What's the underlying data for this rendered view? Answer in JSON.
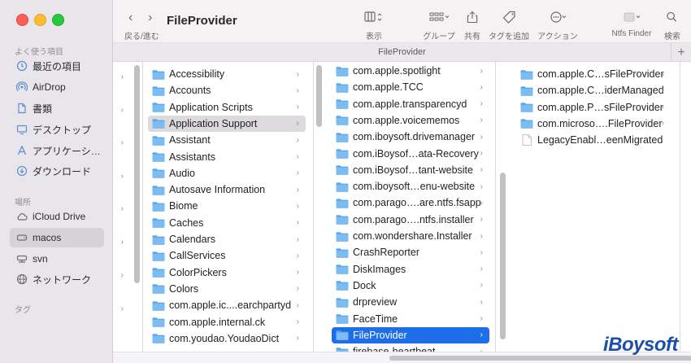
{
  "window": {
    "title": "FileProvider",
    "path_title": "FileProvider"
  },
  "toolbar": {
    "back_icon": "chevron-left-icon",
    "forward_icon": "chevron-right-icon",
    "nav_label": "戻る/進む",
    "view_label": "表示",
    "group_label": "グループ",
    "share_label": "共有",
    "tag_label": "タグを追加",
    "action_label": "アクション",
    "ntfs_label": "Ntfs Finder",
    "search_label": "検索"
  },
  "sidebar": {
    "favorites_header": "よく使う項目",
    "favorites": [
      {
        "label": "最近の項目",
        "icon": "clock-icon"
      },
      {
        "label": "AirDrop",
        "icon": "airdrop-icon"
      },
      {
        "label": "書類",
        "icon": "document-icon"
      },
      {
        "label": "デスクトップ",
        "icon": "desktop-icon"
      },
      {
        "label": "アプリケーシ…",
        "icon": "applications-icon"
      },
      {
        "label": "ダウンロード",
        "icon": "download-icon"
      }
    ],
    "locations_header": "場所",
    "locations": [
      {
        "label": "iCloud Drive",
        "icon": "cloud-icon"
      },
      {
        "label": "macos",
        "icon": "disk-icon",
        "selected": true
      },
      {
        "label": "svn",
        "icon": "network-drive-icon"
      },
      {
        "label": "ネットワーク",
        "icon": "network-icon"
      }
    ],
    "tags_header": "タグ"
  },
  "columns": {
    "col2": [
      "Accessibility",
      "Accounts",
      "Application Scripts",
      "Application Support",
      "Assistant",
      "Assistants",
      "Audio",
      "Autosave Information",
      "Biome",
      "Caches",
      "Calendars",
      "CallServices",
      "ColorPickers",
      "Colors",
      "com.apple.ic....earchpartyd",
      "com.apple.internal.ck",
      "com.youdao.YoudaoDict"
    ],
    "col2_selected": 3,
    "col3": [
      "com.apple.spotlight",
      "com.apple.TCC",
      "com.apple.transparencyd",
      "com.apple.voicememos",
      "com.iboysoft.drivemanager",
      "com.iBoysof…ata-Recovery",
      "com.iBoysof…tant-website",
      "com.iboysoft…enu-website",
      "com.parago….are.ntfs.fsapp",
      "com.parago….ntfs.installer",
      "com.wondershare.Installer",
      "CrashReporter",
      "DiskImages",
      "Dock",
      "drpreview",
      "FaceTime",
      "FileProvider",
      "firebase-heartbeat"
    ],
    "col3_selected": 16,
    "col4": [
      {
        "name": "com.apple.C…sFileProvider",
        "type": "folder"
      },
      {
        "name": "com.apple.C…iderManaged",
        "type": "folder"
      },
      {
        "name": "com.apple.P…sFileProvider",
        "type": "folder"
      },
      {
        "name": "com.microso….FileProvider",
        "type": "folder"
      },
      {
        "name": "LegacyEnabl…eenMigrated",
        "type": "file"
      }
    ]
  },
  "watermark": {
    "text": "iBoysoft"
  },
  "colors": {
    "accent": "#1d6ee8",
    "folder": "#5fa8ea",
    "sidebar_bg": "#e9e6eb"
  }
}
